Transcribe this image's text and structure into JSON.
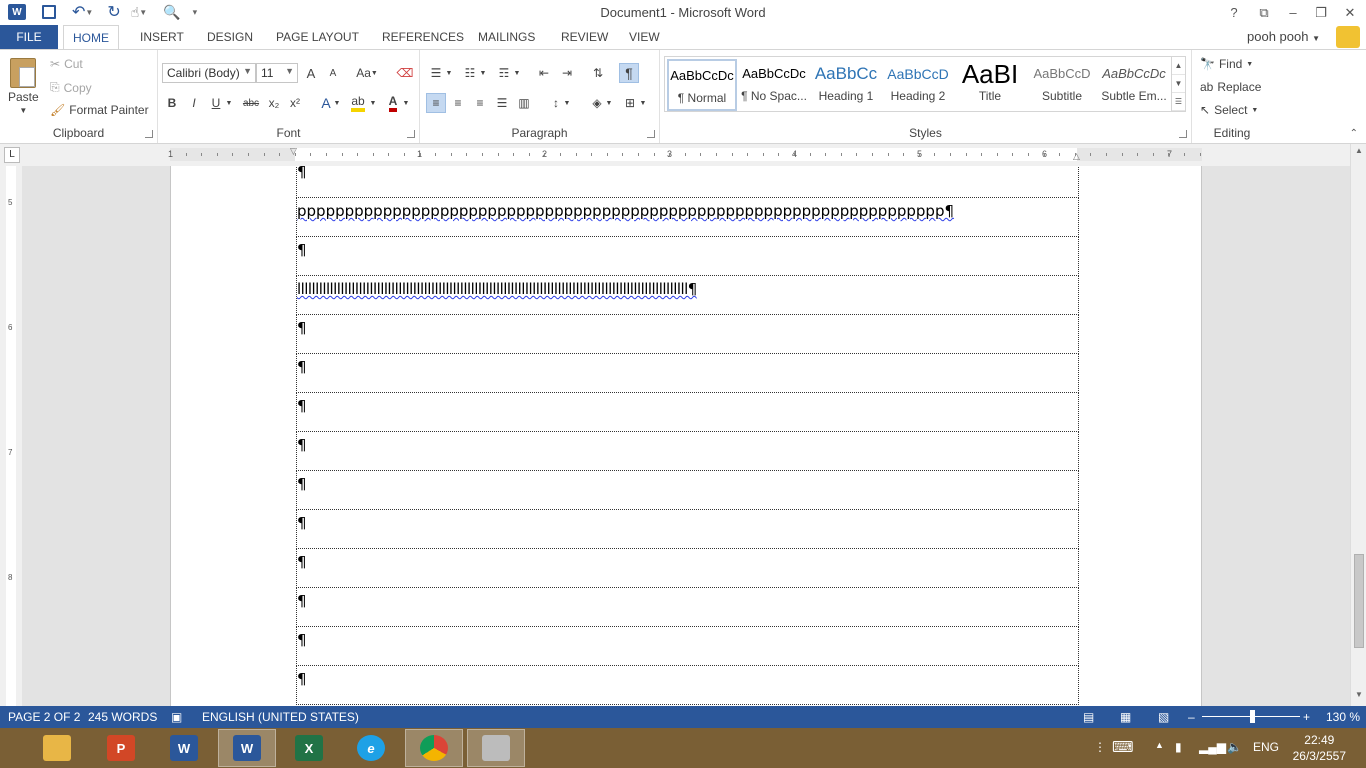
{
  "window": {
    "title": "Document1 - Microsoft Word",
    "help": "?",
    "restore_ribbon": "⧉",
    "minimize": "–",
    "maximize": "❐",
    "close": "✕"
  },
  "tabs": [
    "FILE",
    "HOME",
    "INSERT",
    "DESIGN",
    "PAGE LAYOUT",
    "REFERENCES",
    "MAILINGS",
    "REVIEW",
    "VIEW"
  ],
  "user": {
    "name": "pooh pooh"
  },
  "clipboard": {
    "label": "Clipboard",
    "paste": "Paste",
    "cut": "Cut",
    "copy": "Copy",
    "format_painter": "Format Painter"
  },
  "font": {
    "label": "Font",
    "family": "Calibri (Body)",
    "size": "11",
    "grow": "A",
    "shrink": "A",
    "case": "Aa",
    "bold": "B",
    "italic": "I",
    "underline": "U",
    "strike": "abc",
    "subscript": "x₂",
    "superscript": "x²",
    "effects": "A",
    "font_color": "A"
  },
  "paragraph": {
    "label": "Paragraph",
    "pilcrow": "¶"
  },
  "styles": {
    "label": "Styles",
    "items": [
      {
        "preview": "AaBbCcDc",
        "name": "¶ Normal"
      },
      {
        "preview": "AaBbCcDc",
        "name": "¶ No Spac..."
      },
      {
        "preview": "AaBbCc",
        "name": "Heading 1"
      },
      {
        "preview": "AaBbCcD",
        "name": "Heading 2"
      },
      {
        "preview": "AaBI",
        "name": "Title"
      },
      {
        "preview": "AaBbCcD",
        "name": "Subtitle"
      },
      {
        "preview": "AaBbCcDc",
        "name": "Subtle Em..."
      }
    ]
  },
  "editing": {
    "label": "Editing",
    "find": "Find",
    "replace": "Replace",
    "select": "Select"
  },
  "ruler": {
    "tab_selector": "L",
    "h_numbers": [
      "1",
      "1",
      "2",
      "3",
      "4",
      "5",
      "6",
      "7"
    ],
    "v_numbers": [
      "5",
      "6",
      "7",
      "8"
    ]
  },
  "document": {
    "rows": [
      "¶",
      "pppppppppppppppppppppppppppppppppppppppppppppppppppppppppppppppppppp¶",
      "¶",
      "llllllllllllllllllllllllllllllllllllllllllllllllllllllllllllllllllllllllllllllllllllllllllllllllllllllllllll¶",
      "¶",
      "¶",
      "¶",
      "¶",
      "¶",
      "¶",
      "¶",
      "¶",
      "¶",
      "¶"
    ]
  },
  "status": {
    "page": "PAGE 2 OF 2",
    "words": "245 WORDS",
    "language": "ENGLISH (UNITED STATES)",
    "zoom": "130 %",
    "zoom_minus": "–",
    "zoom_plus": "+"
  },
  "taskbar": {
    "apps": [
      {
        "name": "file-explorer",
        "glyph": "",
        "color": "#e8b646"
      },
      {
        "name": "powerpoint-pdf",
        "glyph": "P",
        "color": "#d24726"
      },
      {
        "name": "word-2013",
        "glyph": "W",
        "color": "#2b579a"
      },
      {
        "name": "word-active",
        "glyph": "W",
        "color": "#2b579a"
      },
      {
        "name": "excel",
        "glyph": "X",
        "color": "#217346"
      },
      {
        "name": "internet-explorer",
        "glyph": "e",
        "color": "#1ea1e6"
      },
      {
        "name": "chrome",
        "glyph": "",
        "color": "#db4437"
      },
      {
        "name": "scanner-app",
        "glyph": "",
        "color": "#bcbcbc"
      }
    ],
    "language": "ENG",
    "time": "22:49",
    "date": "26/3/2557"
  },
  "colors": {
    "brand": "#2b579a",
    "taskbar": "#7a5f35",
    "highlight": "#f5d400",
    "font_color": "#c00000"
  }
}
